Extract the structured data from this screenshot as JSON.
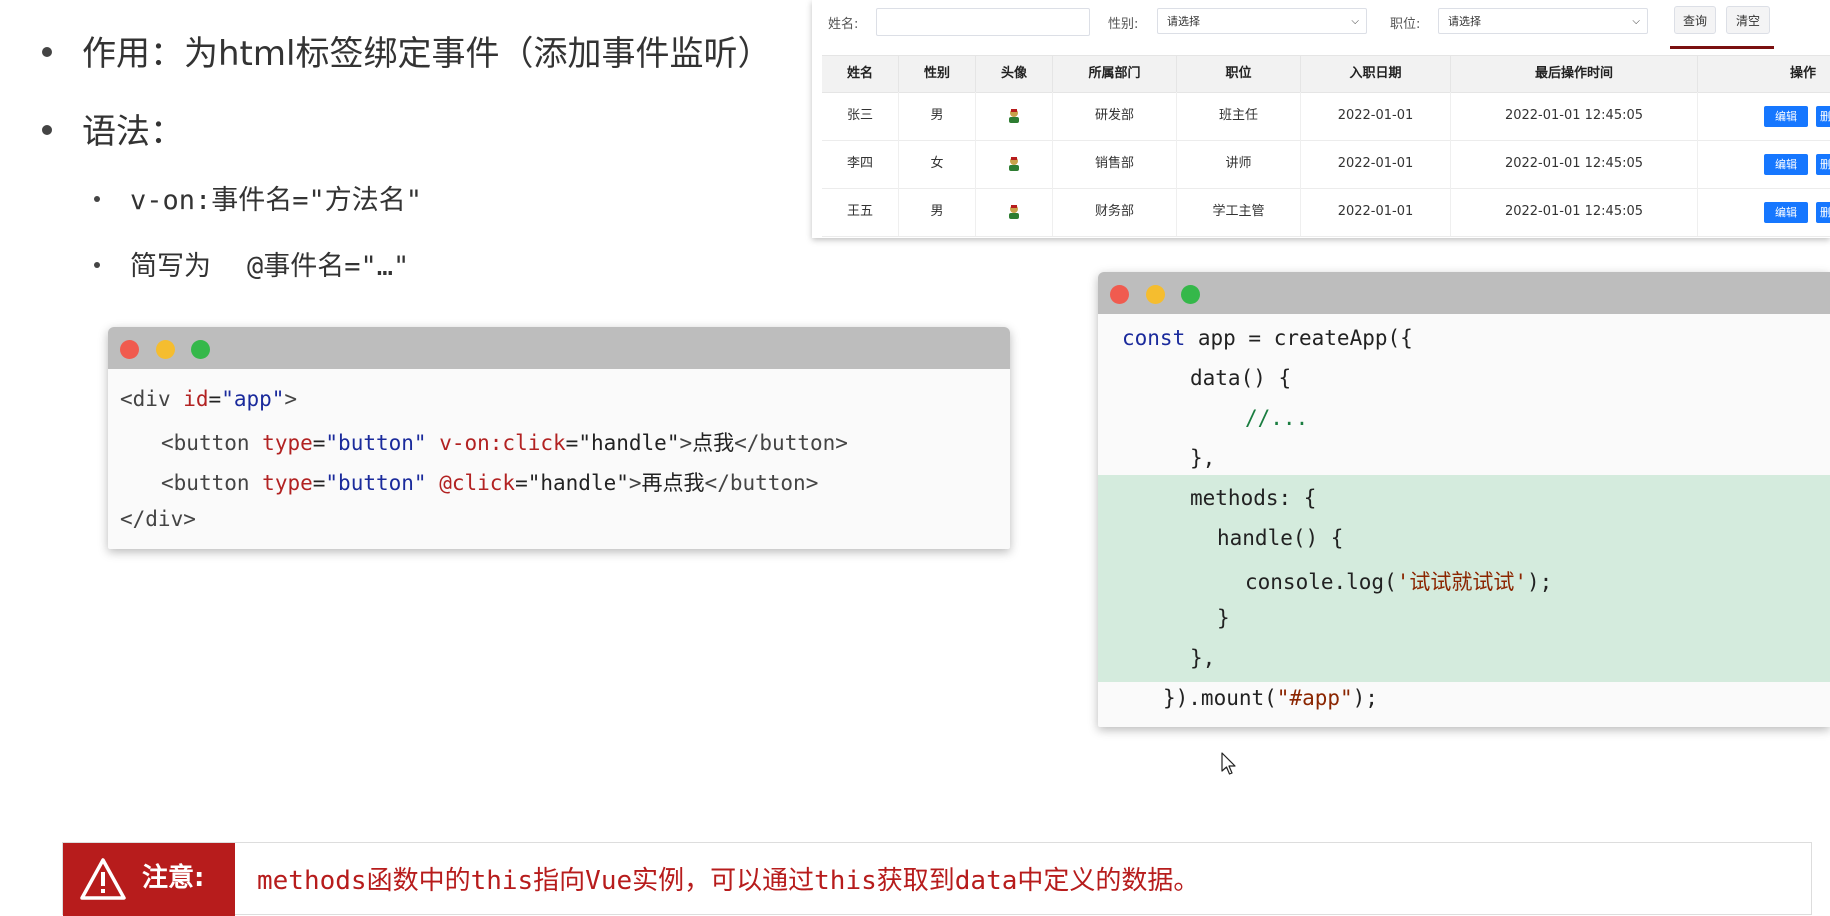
{
  "slide": {
    "bullet1": "作用：为html标签绑定事件（添加事件监听）",
    "bullet2": "语法：",
    "sub1": "v-on:事件名=\"方法名\"",
    "sub2_prefix": "简写为",
    "sub2_code": "@事件名=\"…\""
  },
  "table_panel": {
    "filters": {
      "name_label": "姓名:",
      "name_value": "",
      "gender_label": "性别:",
      "gender_selected": "请选择",
      "position_label": "职位:",
      "position_selected": "请选择",
      "query_button": "查询",
      "clear_button": "清空"
    },
    "columns": [
      "姓名",
      "性别",
      "头像",
      "所属部门",
      "职位",
      "入职日期",
      "最后操作时间",
      "操作"
    ],
    "rows": [
      {
        "name": "张三",
        "gender": "男",
        "dept": "研发部",
        "position": "班主任",
        "entry_date": "2022-01-01",
        "last_op": "2022-01-01 12:45:05",
        "edit": "编辑",
        "delete": "删"
      },
      {
        "name": "李四",
        "gender": "女",
        "dept": "销售部",
        "position": "讲师",
        "entry_date": "2022-01-01",
        "last_op": "2022-01-01 12:45:05",
        "edit": "编辑",
        "delete": "删"
      },
      {
        "name": "王五",
        "gender": "男",
        "dept": "财务部",
        "position": "学工主管",
        "entry_date": "2022-01-01",
        "last_op": "2022-01-01 12:45:05",
        "edit": "编辑",
        "delete": "删"
      }
    ],
    "avatar_icon": "avatar-icon"
  },
  "code_left": {
    "l1_open": "<",
    "l1_tag": "div",
    "l1_attr": "id",
    "l1_eq": "=",
    "l1_val": "\"app\"",
    "l1_close": ">",
    "l2_open": "<",
    "l2_tag": "button",
    "l2_attr1": "type",
    "l2_eq1": "=",
    "l2_val1": "\"button\"",
    "l2_attr2": "v-on:click",
    "l2_eq2": "=",
    "l2_val2": "\"handle\"",
    "l2_close": ">",
    "l2_text": "点我",
    "l2_end": "</button>",
    "l3_open": "<",
    "l3_tag": "button",
    "l3_attr1": "type",
    "l3_eq1": "=",
    "l3_val1": "\"button\"",
    "l3_attr2": "@click",
    "l3_eq2": "=",
    "l3_val2": "\"handle\"",
    "l3_close": ">",
    "l3_text": "再点我",
    "l3_end": "</button>",
    "l4": "</div>"
  },
  "code_right": {
    "l1_kw": "const",
    "l1_rest": " app = createApp({",
    "l2": "data() {",
    "l3": "//...",
    "l4": "},",
    "l5": "methods: {",
    "l6": "handle() {",
    "l7_a": "console.log(",
    "l7_str": "'试试就试试'",
    "l7_b": ");",
    "l8": "}",
    "l9": "},",
    "l10_a": "}).mount(",
    "l10_str": "\"#app\"",
    "l10_b": ");"
  },
  "note": {
    "icon": "warning-icon",
    "label": "注意:",
    "text": "methods函数中的this指向Vue实例，可以通过this获取到data中定义的数据。"
  },
  "colors": {
    "accent_red": "#b71c1c",
    "button_blue": "#1677ff",
    "highlight_green": "#d4ebdd",
    "keyword_blue": "#1a2a9c",
    "attr_red": "#b22222"
  }
}
